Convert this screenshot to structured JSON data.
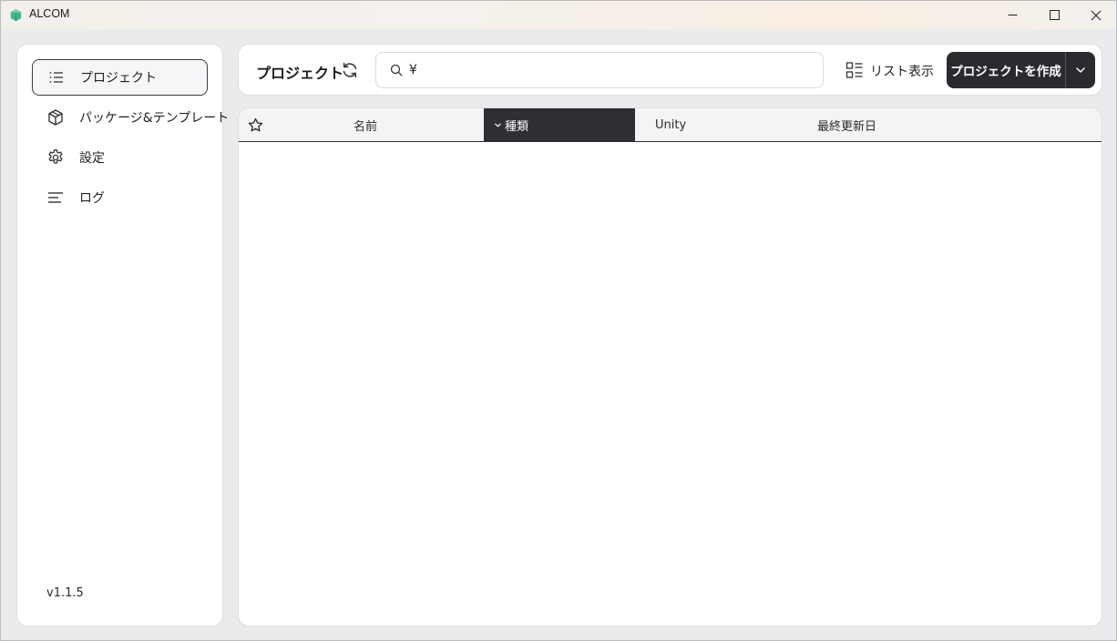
{
  "window": {
    "title": "ALCOM"
  },
  "sidebar": {
    "items": [
      {
        "label": "プロジェクト",
        "icon": "list-icon",
        "active": true
      },
      {
        "label": "パッケージ&テンプレート",
        "icon": "package-icon",
        "active": false
      },
      {
        "label": "設定",
        "icon": "gear-icon",
        "active": false
      },
      {
        "label": "ログ",
        "icon": "log-lines-icon",
        "active": false
      }
    ],
    "version": "v1.1.5"
  },
  "toolbar": {
    "title": "プロジェクト",
    "search": {
      "value": "¥",
      "placeholder": ""
    },
    "view_label": "リスト表示",
    "create_label": "プロジェクトを作成"
  },
  "table": {
    "columns": [
      {
        "key": "favorite",
        "label": "",
        "icon": "star-icon"
      },
      {
        "key": "name",
        "label": "名前"
      },
      {
        "key": "type",
        "label": "種類",
        "sorted": "desc"
      },
      {
        "key": "unity",
        "label": "Unity"
      },
      {
        "key": "last_modified",
        "label": "最終更新日"
      }
    ],
    "rows": []
  },
  "colors": {
    "accent_dark": "#2b2a30",
    "app_logo": "#3fb98a"
  }
}
